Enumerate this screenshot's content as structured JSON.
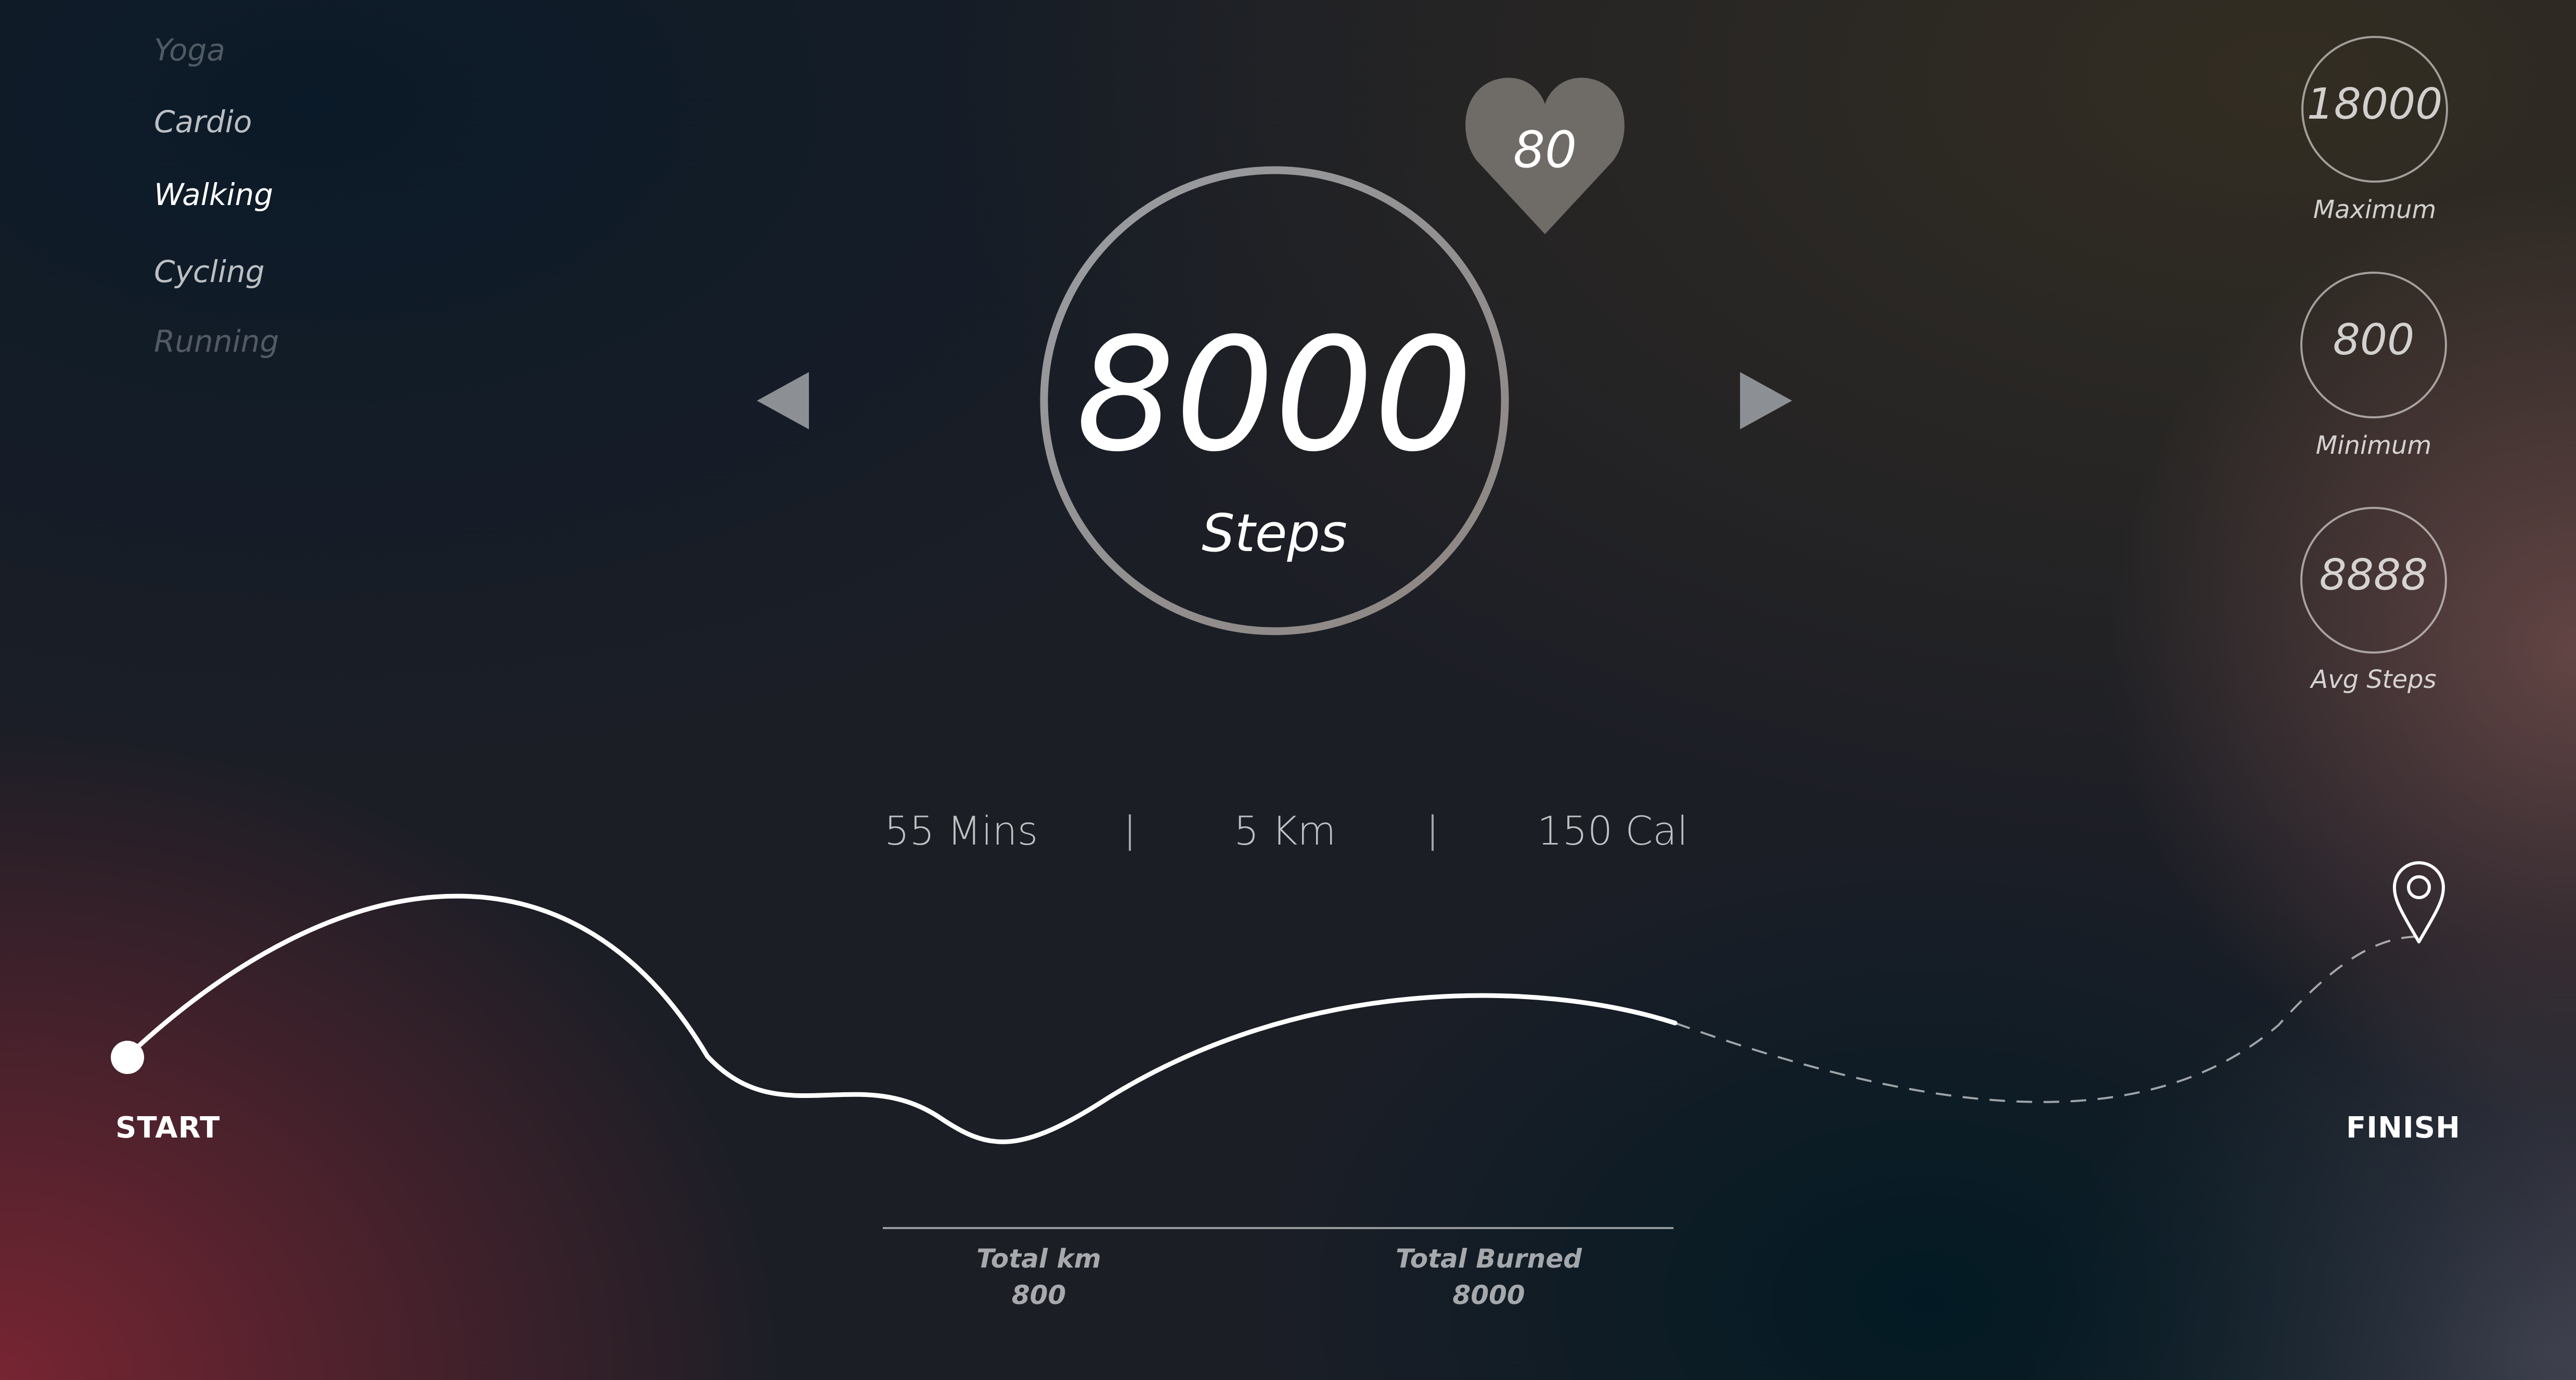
{
  "menu": {
    "items": [
      {
        "label": "Yoga"
      },
      {
        "label": "Cardio"
      },
      {
        "label": "Walking"
      },
      {
        "label": "Cycling"
      },
      {
        "label": "Running"
      }
    ],
    "selected": "Walking"
  },
  "heart_rate": {
    "value": "80",
    "icon": "heart-icon"
  },
  "steps": {
    "value": "8000",
    "label": "Steps"
  },
  "navigation": {
    "prev_icon": "triangle-left-icon",
    "next_icon": "triangle-right-icon"
  },
  "summary": {
    "items": [
      {
        "value": "18000",
        "label": "Maximum"
      },
      {
        "value": "800",
        "label": "Minimum"
      },
      {
        "value": "8888",
        "label": "Avg Steps"
      }
    ]
  },
  "stats": {
    "duration": "55 Mins",
    "distance": "5 Km",
    "calories": "150 Cal"
  },
  "route": {
    "start_label": "START",
    "finish_label": "FINISH",
    "finish_icon": "map-pin-icon",
    "progress": 0.65
  },
  "totals": {
    "km_label": "Total km",
    "km_value": "800",
    "burned_label": "Total Burned",
    "burned_value": "8000"
  }
}
